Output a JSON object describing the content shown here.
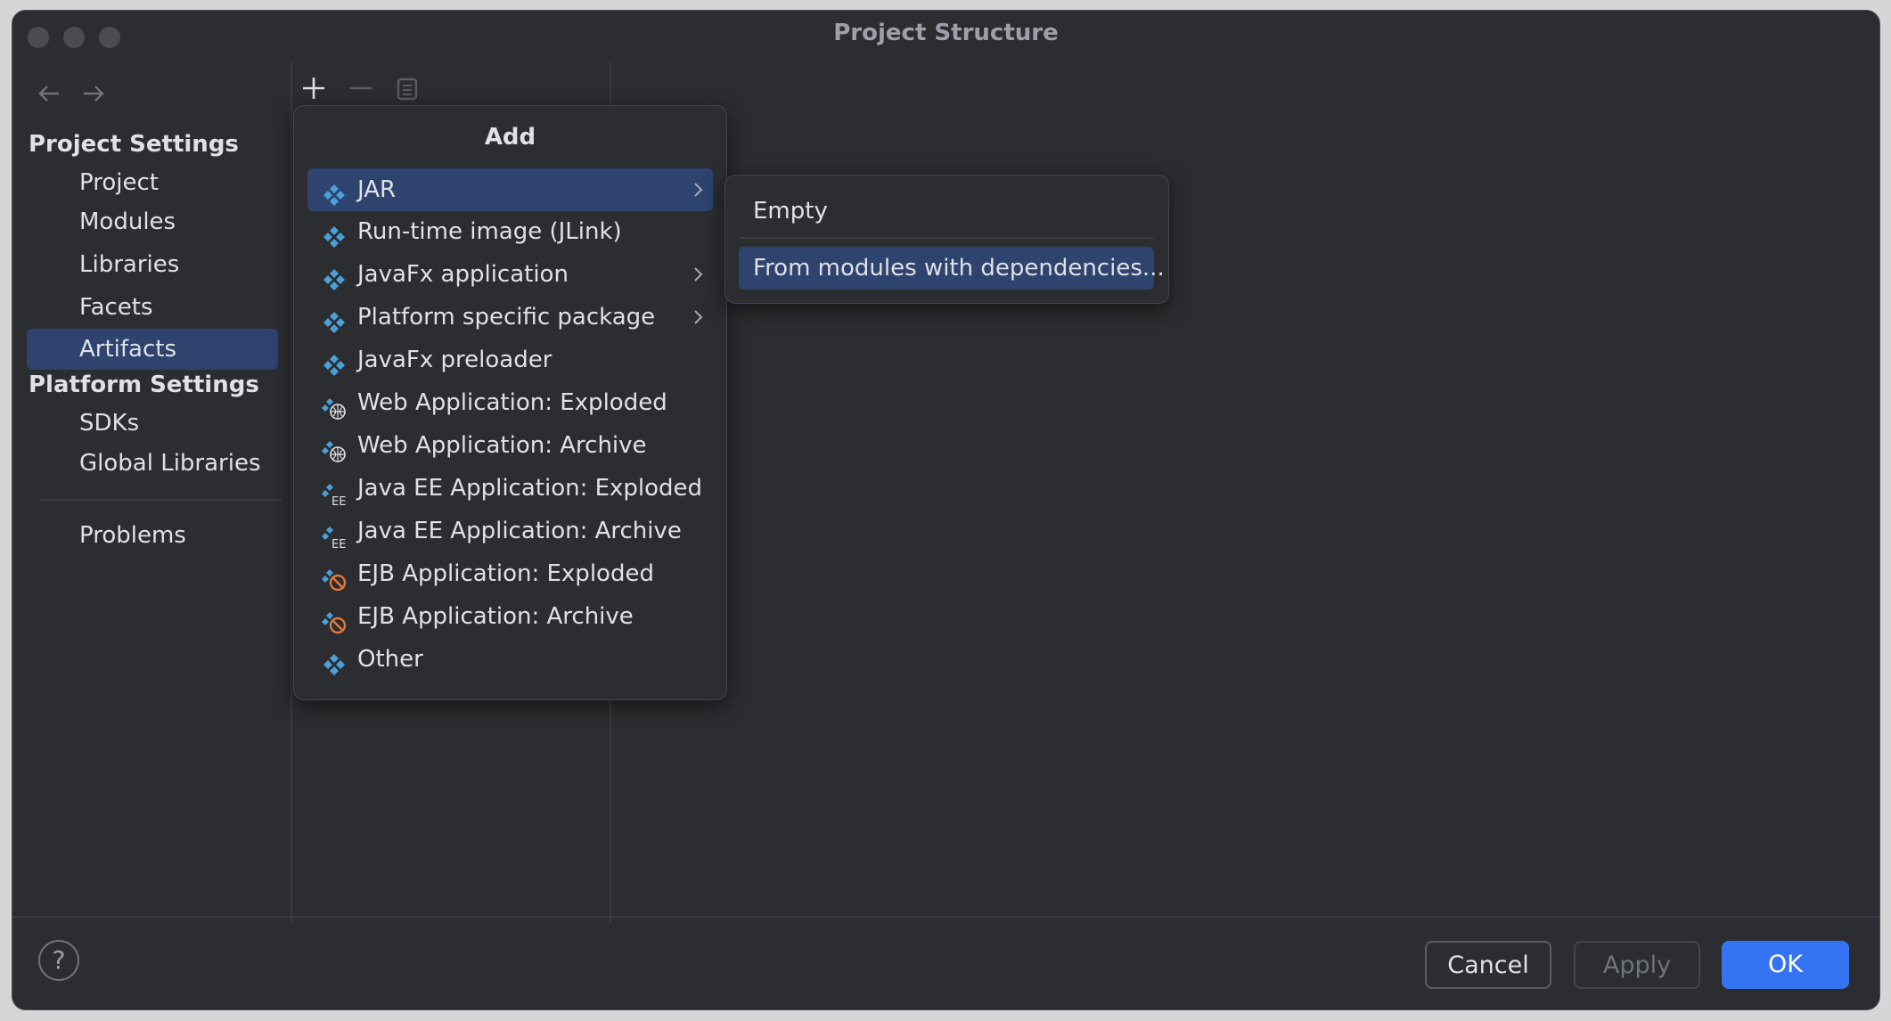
{
  "window": {
    "title": "Project Structure"
  },
  "nav": {
    "back_icon": "arrow-left-icon",
    "forward_icon": "arrow-right-icon"
  },
  "sidebar": {
    "project_settings_header": "Project Settings",
    "project_items": [
      "Project",
      "Modules",
      "Libraries",
      "Facets",
      "Artifacts"
    ],
    "selected": "Artifacts",
    "platform_settings_header": "Platform Settings",
    "platform_items": [
      "SDKs",
      "Global Libraries"
    ],
    "problems": "Problems"
  },
  "toolbar": {
    "add_icon": "plus-icon",
    "remove_icon": "minus-icon",
    "copy_icon": "copy-icon"
  },
  "add_popup": {
    "title": "Add",
    "items": [
      {
        "label": "JAR",
        "icon": "artifact-icon",
        "submenu": true,
        "selected": true
      },
      {
        "label": "Run-time image (JLink)",
        "icon": "artifact-icon",
        "submenu": false
      },
      {
        "label": "JavaFx application",
        "icon": "artifact-icon",
        "submenu": true
      },
      {
        "label": "Platform specific package",
        "icon": "artifact-icon",
        "submenu": true
      },
      {
        "label": "JavaFx preloader",
        "icon": "artifact-icon",
        "submenu": false
      },
      {
        "label": "Web Application: Exploded",
        "icon": "web-artifact-icon",
        "submenu": false
      },
      {
        "label": "Web Application: Archive",
        "icon": "web-artifact-icon",
        "submenu": false
      },
      {
        "label": "Java EE Application: Exploded",
        "icon": "javaee-artifact-icon",
        "submenu": false
      },
      {
        "label": "Java EE Application: Archive",
        "icon": "javaee-artifact-icon",
        "submenu": false
      },
      {
        "label": "EJB Application: Exploded",
        "icon": "ejb-artifact-icon",
        "submenu": false
      },
      {
        "label": "EJB Application: Archive",
        "icon": "ejb-artifact-icon",
        "submenu": false
      },
      {
        "label": "Other",
        "icon": "artifact-icon",
        "submenu": false
      }
    ]
  },
  "jar_submenu": {
    "items": [
      "Empty",
      "From modules with dependencies..."
    ],
    "selected": "From modules with dependencies..."
  },
  "footer": {
    "help": "?",
    "cancel": "Cancel",
    "apply": "Apply",
    "ok": "OK"
  },
  "colors": {
    "accent": "#3574f0",
    "selection": "#2e436e",
    "background": "#2b2d30",
    "icon_blue": "#4ba0d9",
    "icon_orange": "#e0763a"
  }
}
